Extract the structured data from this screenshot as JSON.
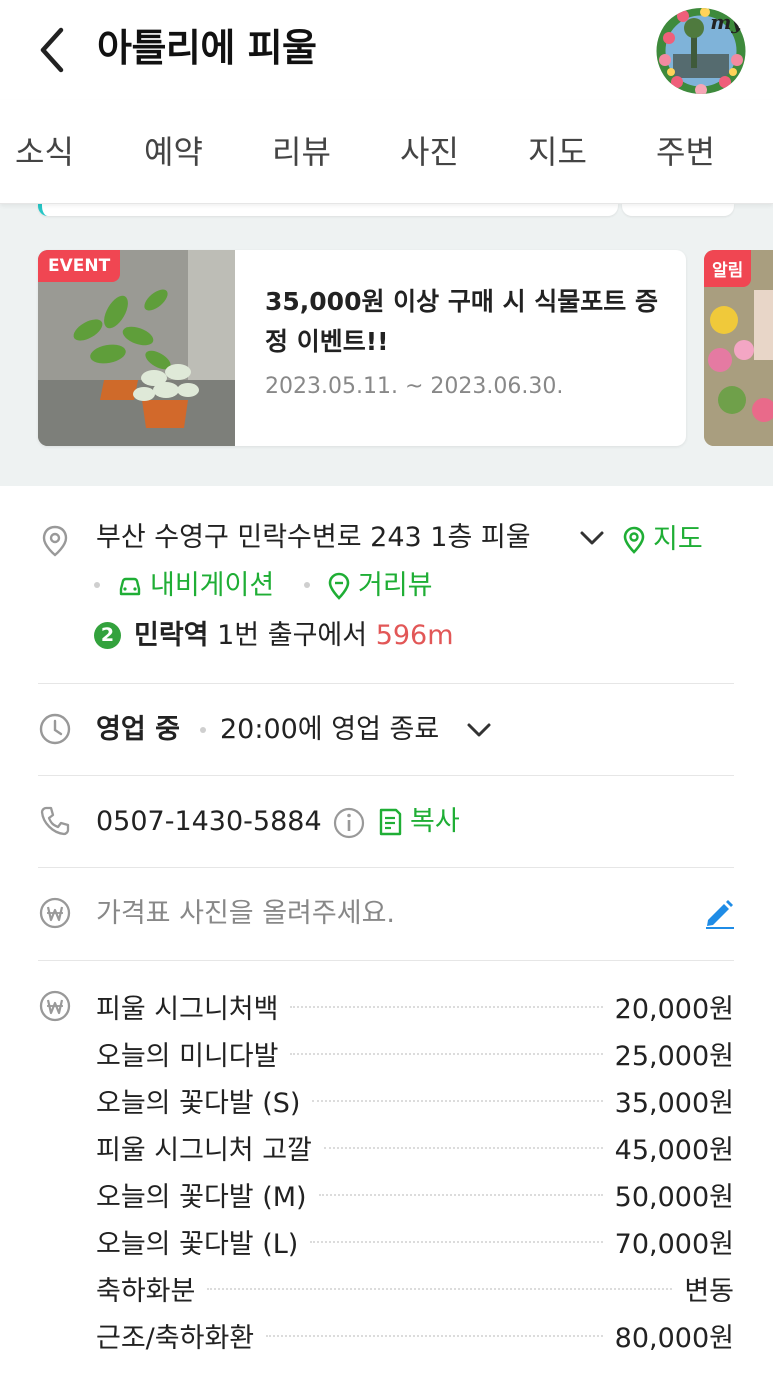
{
  "header": {
    "title": "아틀리에 피울",
    "avatar_label": "my"
  },
  "tabs": [
    "소식",
    "예약",
    "리뷰",
    "사진",
    "지도",
    "주변"
  ],
  "event": {
    "badge": "EVENT",
    "title": "35,000원 이상 구매 시 식물포트 증정 이벤트!!",
    "date": "2023.05.11. ~ 2023.06.30."
  },
  "notice": {
    "badge": "알림"
  },
  "address": {
    "text": "부산 수영구 민락수변로 243 1층 피울",
    "map_link": "지도",
    "navigation_link": "내비게이션",
    "streetview_link": "거리뷰"
  },
  "subway": {
    "line_number": "2",
    "line_color": "#33a23d",
    "station": "민락역",
    "exit_text": "1번 출구에서",
    "distance": "596m"
  },
  "hours": {
    "status": "영업 중",
    "detail": "20:00에 영업 종료"
  },
  "phone": {
    "number": "0507-1430-5884",
    "copy_label": "복사"
  },
  "price_photo": {
    "placeholder": "가격표 사진을 올려주세요."
  },
  "prices": [
    {
      "name": "피울 시그니처백",
      "value": "20,000원"
    },
    {
      "name": "오늘의 미니다발",
      "value": "25,000원"
    },
    {
      "name": "오늘의 꽃다발 (S)",
      "value": "35,000원"
    },
    {
      "name": "피울 시그니처 고깔",
      "value": "45,000원"
    },
    {
      "name": "오늘의 꽃다발 (M)",
      "value": "50,000원"
    },
    {
      "name": "오늘의 꽃다발 (L)",
      "value": "70,000원"
    },
    {
      "name": "축하화분",
      "value": "변동"
    },
    {
      "name": "근조/축하화환",
      "value": "80,000원"
    }
  ],
  "colors": {
    "accent_green": "#1fae35",
    "badge_red": "#f04652",
    "distance_red": "#e25757",
    "edit_blue": "#1f8ce6"
  }
}
